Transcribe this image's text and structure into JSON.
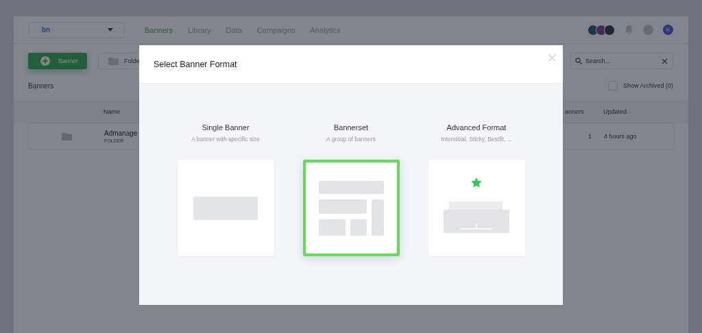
{
  "topbar": {
    "workspace": "bn",
    "nav": [
      {
        "label": "Banners",
        "selected": true
      },
      {
        "label": "Library",
        "selected": false
      },
      {
        "label": "Data",
        "selected": false
      },
      {
        "label": "Campaigns",
        "selected": false
      },
      {
        "label": "Analytics",
        "selected": false
      }
    ],
    "user_avatar": "K"
  },
  "toolbar": {
    "new_button": "Banner",
    "folder_button": "Folde",
    "search": {
      "placeholder": "Search..."
    }
  },
  "section": {
    "title": "Banners",
    "show_archived": {
      "label": "Show Archived (0)",
      "checked": false
    }
  },
  "table": {
    "columns": [
      "Name",
      "anners",
      "Updated"
    ],
    "rows": [
      {
        "name": "Admanage",
        "type": "FOLDER",
        "count": "1",
        "updated": "4 hours ago"
      }
    ]
  },
  "modal": {
    "title": "Select Banner Format",
    "options": [
      {
        "kind": "single",
        "title": "Single Banner",
        "subtitle": "A banner with specific size",
        "selected": false
      },
      {
        "kind": "set",
        "title": "Bannerset",
        "subtitle": "A group of banners",
        "selected": true
      },
      {
        "kind": "advanced",
        "title": "Advanced Format",
        "subtitle": "Interstitial, Sticky, Bestfit, ...",
        "selected": false
      }
    ]
  }
}
